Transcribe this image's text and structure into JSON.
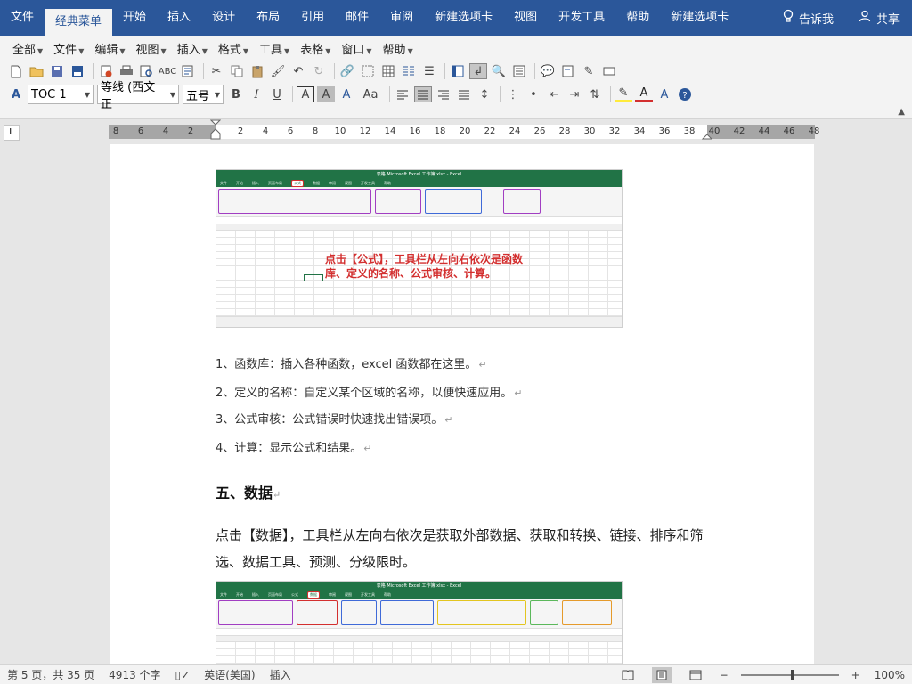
{
  "ribbon": {
    "tabs": [
      "文件",
      "经典菜单",
      "开始",
      "插入",
      "设计",
      "布局",
      "引用",
      "邮件",
      "审阅",
      "新建选项卡",
      "视图",
      "开发工具",
      "帮助",
      "新建选项卡"
    ],
    "active_tab": "经典菜单",
    "tell_me": "告诉我",
    "share": "共享"
  },
  "classic_menu": {
    "items": [
      "全部",
      "文件",
      "编辑",
      "视图",
      "插入",
      "格式",
      "工具",
      "表格",
      "窗口",
      "帮助"
    ]
  },
  "format": {
    "style": "TOC 1",
    "font": "等线 (西文正",
    "size": "五号",
    "bold_label": "B",
    "italic_label": "I",
    "underline_label": "U",
    "char_border_label": "A",
    "char_shade_label": "A",
    "case_label": "Aa"
  },
  "ruler": {
    "tab_selector": "L",
    "left_numbers": [
      "8",
      "6",
      "4",
      "2"
    ],
    "right_numbers": [
      "2",
      "4",
      "6",
      "8",
      "10",
      "12",
      "14",
      "16",
      "18",
      "20",
      "22",
      "24",
      "26",
      "28",
      "30",
      "32",
      "34",
      "36",
      "38",
      "40",
      "42",
      "44",
      "46",
      "48"
    ]
  },
  "document": {
    "screenshot1": {
      "title": "表格 Microsoft Excel 工作簿.xlsx - Excel",
      "tabs": [
        "文件",
        "开始",
        "插入",
        "页面布局",
        "公式",
        "数据",
        "审阅",
        "视图",
        "开发工具",
        "帮助"
      ],
      "selected_tab": "公式",
      "annotation_line1": "点击【公式】，工具栏从左向右依次是函数",
      "annotation_line2": "库、定义的名称、公式审核、计算。"
    },
    "list": [
      "1、函数库：插入各种函数，excel 函数都在这里。",
      "2、定义的名称：自定义某个区域的名称，以便快速应用。",
      "3、公式审核：公式错误时快速找出错误项。",
      "4、计算：显示公式和结果。"
    ],
    "heading": "五、数据",
    "paragraph": "点击【数据】，工具栏从左向右依次是获取外部数据、获取和转换、链接、排序和筛选、数据工具、预测、分级限时。",
    "screenshot2": {
      "title": "表格 Microsoft Excel 工作簿.xlsx - Excel",
      "tabs": [
        "文件",
        "开始",
        "插入",
        "页面布局",
        "公式",
        "数据",
        "审阅",
        "视图",
        "开发工具",
        "帮助"
      ],
      "selected_tab": "数据"
    }
  },
  "statusbar": {
    "page": "第 5 页，共 35 页",
    "words": "4913 个字",
    "language": "英语(美国)",
    "mode": "插入",
    "zoom": "100%"
  }
}
